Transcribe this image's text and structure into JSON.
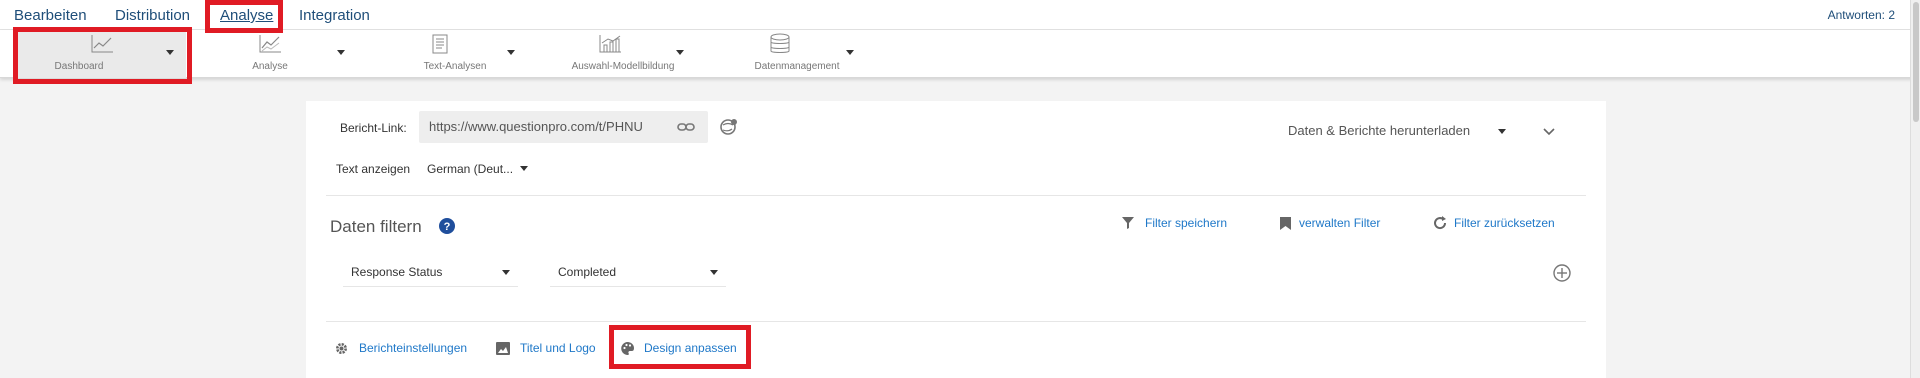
{
  "nav": {
    "tabs": [
      {
        "label": "Bearbeiten"
      },
      {
        "label": "Distribution"
      },
      {
        "label": "Analyse"
      },
      {
        "label": "Integration"
      }
    ],
    "answers": "Antworten: 2"
  },
  "toolbar": {
    "items": [
      {
        "label": "Dashboard",
        "icon": "line-chart-icon"
      },
      {
        "label": "Analyse",
        "icon": "line-chart-icon"
      },
      {
        "label": "Text-Analysen",
        "icon": "text-document-icon"
      },
      {
        "label": "Auswahl-Modellbildung",
        "icon": "bar-line-chart-icon"
      },
      {
        "label": "Datenmanagement",
        "icon": "database-icon"
      }
    ]
  },
  "report": {
    "link_label": "Bericht-Link:",
    "link_value": "https://www.questionpro.com/t/PHNU",
    "download_label": "Daten & Berichte herunterladen",
    "text_label": "Text anzeigen",
    "language": "German (Deut..."
  },
  "filter": {
    "title": "Daten filtern",
    "save": "Filter speichern",
    "manage": "verwalten Filter",
    "reset": "Filter zurücksetzen",
    "field": "Response Status",
    "value": "Completed"
  },
  "settings": {
    "report_settings": "Berichteinstellungen",
    "title_logo": "Titel und Logo",
    "design": "Design anpassen"
  },
  "colors": {
    "nav_text": "#1f4e79",
    "link_blue": "#1f78c8",
    "highlight": "#e01b24"
  }
}
